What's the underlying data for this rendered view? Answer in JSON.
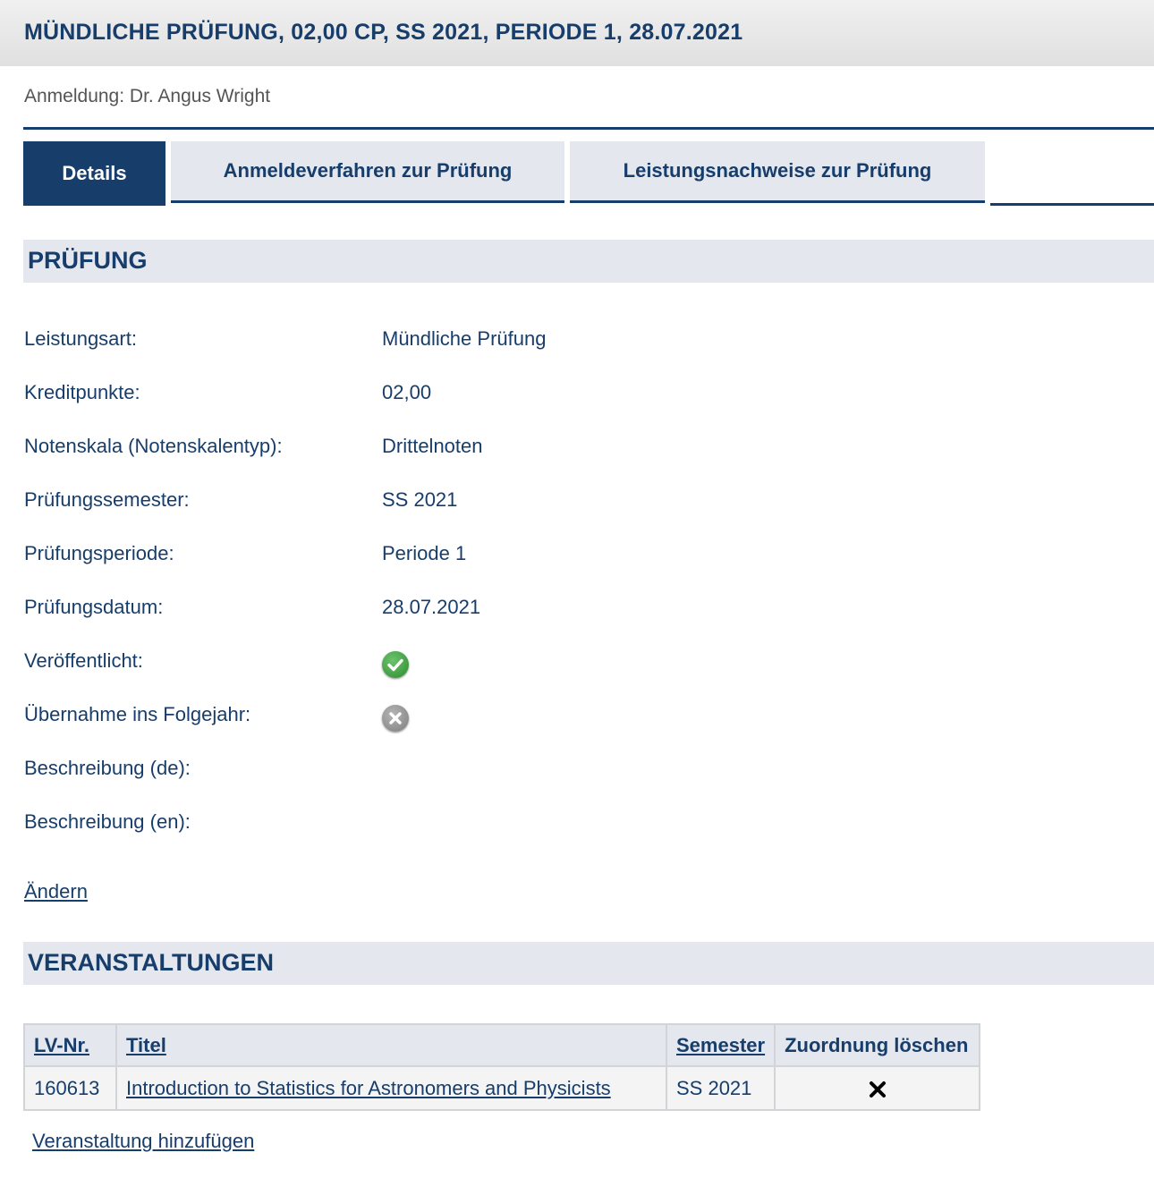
{
  "header": {
    "title": "MÜNDLICHE PRÜFUNG, 02,00 CP, SS 2021, PERIODE 1, 28.07.2021",
    "subtitle": "Anmeldung: Dr. Angus Wright"
  },
  "tabs": [
    {
      "label": "Details",
      "active": true
    },
    {
      "label": "Anmeldeverfahren zur Prüfung",
      "active": false
    },
    {
      "label": "Leistungsnachweise zur Prüfung",
      "active": false
    }
  ],
  "exam_section": {
    "heading": "PRÜFUNG",
    "fields": [
      {
        "label": "Leistungsart:",
        "value": "Mündliche Prüfung"
      },
      {
        "label": "Kreditpunkte:",
        "value": "02,00"
      },
      {
        "label": "Notenskala (Notenskalentyp):",
        "value": "Drittelnoten"
      },
      {
        "label": "Prüfungssemester:",
        "value": "SS 2021"
      },
      {
        "label": "Prüfungsperiode:",
        "value": "Periode 1"
      },
      {
        "label": "Prüfungsdatum:",
        "value": "28.07.2021"
      },
      {
        "label": "Veröffentlicht:",
        "icon": "check-circle-icon"
      },
      {
        "label": "Übernahme ins Folgejahr:",
        "icon": "x-circle-icon"
      },
      {
        "label": "Beschreibung (de):",
        "value": ""
      },
      {
        "label": "Beschreibung (en):",
        "value": ""
      }
    ],
    "edit_link": "Ändern"
  },
  "courses_section": {
    "heading": "VERANSTALTUNGEN",
    "columns": [
      "LV-Nr.",
      "Titel",
      "Semester",
      "Zuordnung löschen"
    ],
    "rows": [
      {
        "lv_nr": "160613",
        "title": "Introduction to Statistics for Astronomers and Physicists",
        "semester": "SS 2021",
        "delete_icon": "close-icon"
      }
    ],
    "add_link": "Veranstaltung hinzufügen"
  },
  "colors": {
    "primary": "#173d6b",
    "section_bg": "#e4e7ee",
    "ok_green": "#2e8b2e",
    "no_gray": "#7d7d7d"
  }
}
